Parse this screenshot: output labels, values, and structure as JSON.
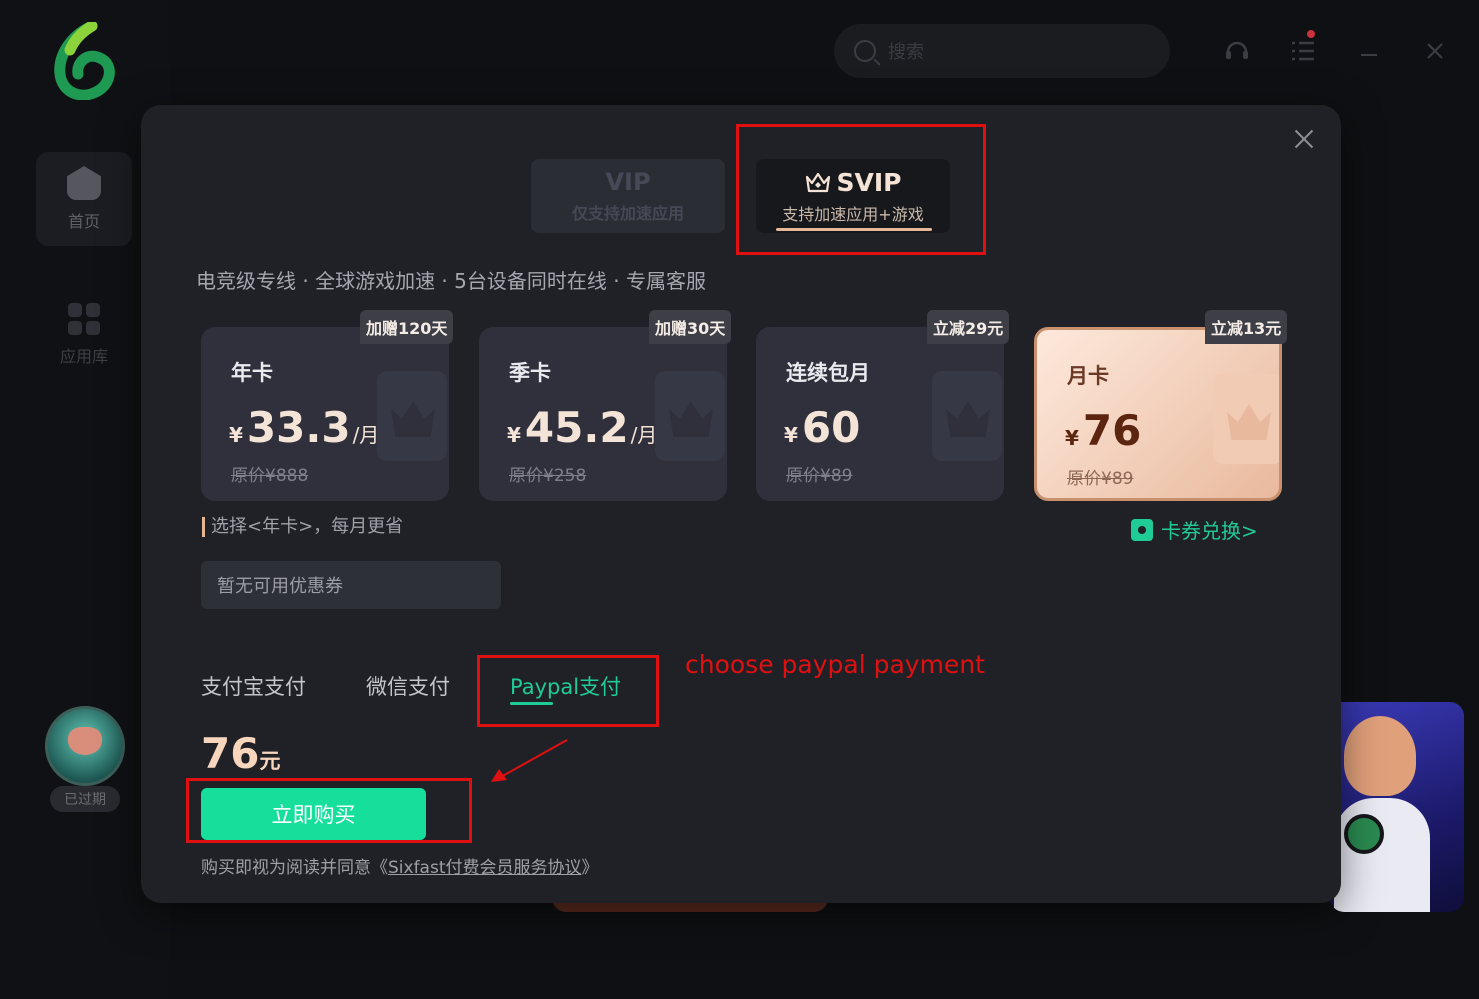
{
  "app": {
    "nav": [
      {
        "label": "首页",
        "icon": "home-bolt-icon"
      },
      {
        "label": "应用库",
        "icon": "apps-grid-icon"
      }
    ],
    "user_status": "已过期",
    "search_placeholder": "搜索"
  },
  "modal": {
    "tiers": [
      {
        "title": "VIP",
        "subtitle": "仅支持加速应用",
        "selected": false
      },
      {
        "title": "SVIP",
        "subtitle": "支持加速应用+游戏",
        "selected": true
      }
    ],
    "features": "电竞级专线 · 全球游戏加速 · 5台设备同时在线 · 专属客服",
    "plans": [
      {
        "name": "年卡",
        "currency": "¥",
        "price": "33.3",
        "per": "/月",
        "original": "原价¥888",
        "badge": "加赠120天",
        "selected": false
      },
      {
        "name": "季卡",
        "currency": "¥",
        "price": "45.2",
        "per": "/月",
        "original": "原价¥258",
        "badge": "加赠30天",
        "selected": false
      },
      {
        "name": "连续包月",
        "currency": "¥",
        "price": "60",
        "per": "",
        "original": "原价¥89",
        "badge": "立减29元",
        "selected": false
      },
      {
        "name": "月卡",
        "currency": "¥",
        "price": "76",
        "per": "",
        "original": "原价¥89",
        "badge": "立减13元",
        "selected": true
      }
    ],
    "hint": "选择<年卡>，每月更省",
    "redeem_label": "卡券兑换>",
    "coupon_text": "暂无可用优惠券",
    "payment_methods": [
      {
        "label": "支付宝支付",
        "selected": false
      },
      {
        "label": "微信支付",
        "selected": false
      },
      {
        "label": "Paypal支付",
        "selected": true
      }
    ],
    "total_amount": "76",
    "total_unit": "元",
    "buy_label": "立即购买",
    "agreement_prefix": "购买即视为阅读并同意《",
    "agreement_link": "Sixfast付费会员服务协议",
    "agreement_suffix": "》"
  },
  "annotation": {
    "text": "choose paypal payment",
    "color": "#e01010"
  },
  "colors": {
    "accent_green": "#16df9c",
    "modal_bg": "#202127",
    "gold": "#f7d6bd"
  }
}
